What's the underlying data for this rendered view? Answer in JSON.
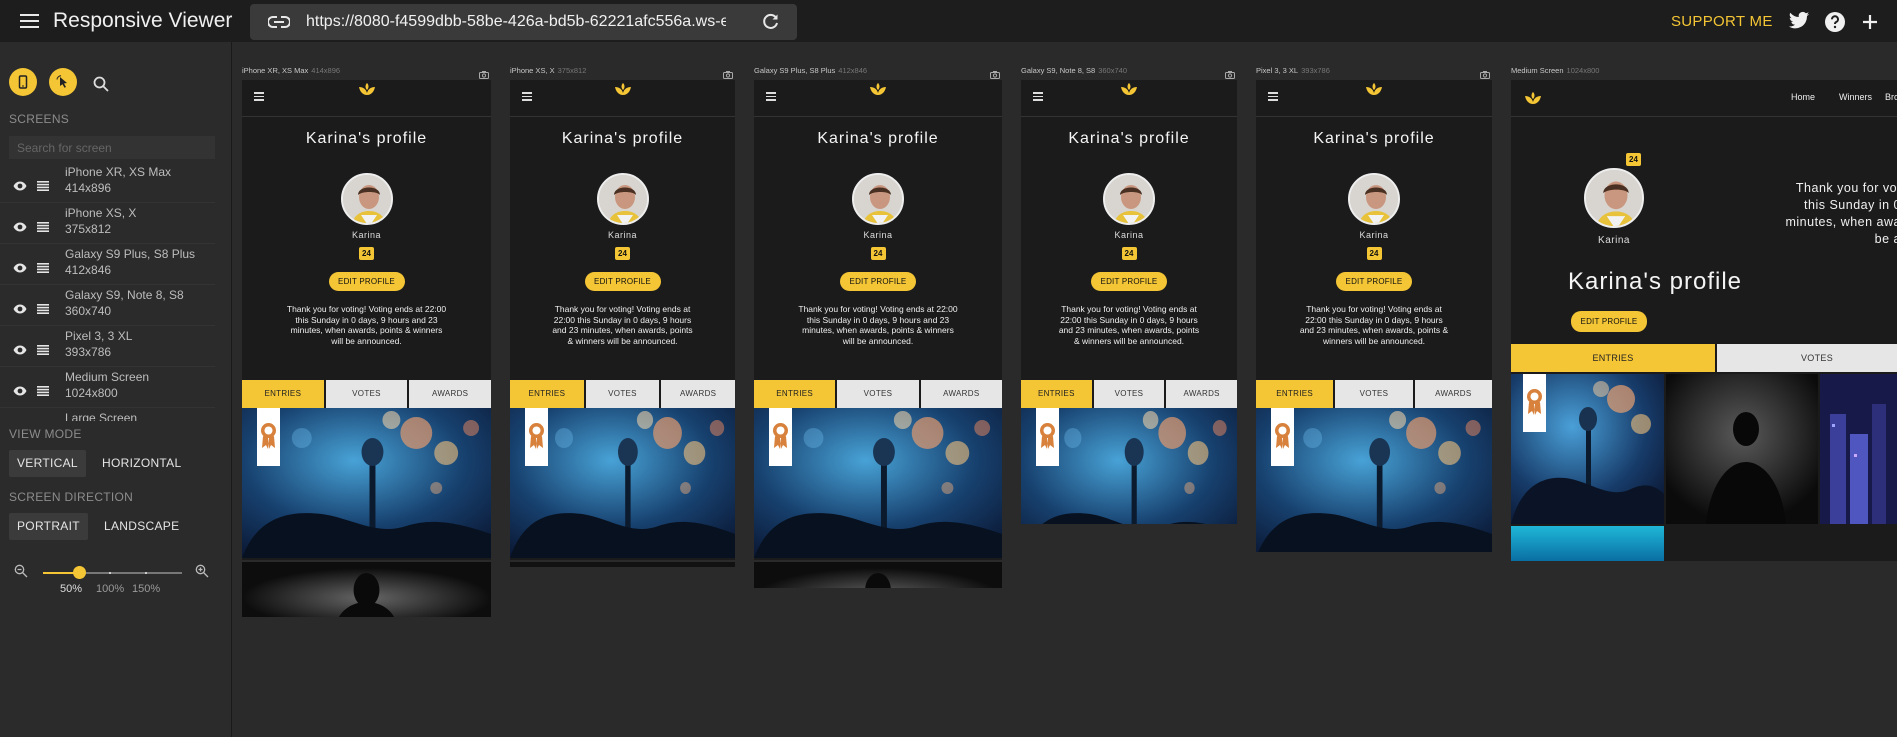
{
  "app": {
    "title": "Responsive Viewer",
    "url": "https://8080-f4599dbb-58be-426a-bd5b-62221afc556a.ws-eu0",
    "support_label": "SUPPORT ME"
  },
  "sidebar": {
    "screens_label": "SCREENS",
    "search_placeholder": "Search for screen",
    "screens": [
      {
        "name": "iPhone XR, XS Max",
        "dims": "414x896"
      },
      {
        "name": "iPhone XS, X",
        "dims": "375x812"
      },
      {
        "name": "Galaxy S9 Plus, S8 Plus",
        "dims": "412x846"
      },
      {
        "name": "Galaxy S9, Note 8, S8",
        "dims": "360x740"
      },
      {
        "name": "Pixel 3, 3 XL",
        "dims": "393x786"
      },
      {
        "name": "Medium Screen",
        "dims": "1024x800"
      },
      {
        "name": "Large Screen",
        "dims": ""
      }
    ],
    "view_mode_label": "VIEW MODE",
    "view_modes": [
      "VERTICAL",
      "HORIZONTAL"
    ],
    "view_mode_selected": "VERTICAL",
    "direction_label": "SCREEN DIRECTION",
    "directions": [
      "PORTRAIT",
      "LANDSCAPE"
    ],
    "direction_selected": "PORTRAIT",
    "zoom_levels": [
      "50%",
      "100%",
      "150%"
    ],
    "zoom_selected": "50%"
  },
  "devices": [
    {
      "label": "iPhone XR, XS Max",
      "dims": "414x896"
    },
    {
      "label": "iPhone XS, X",
      "dims": "375x812"
    },
    {
      "label": "Galaxy S9 Plus, S8 Plus",
      "dims": "412x846"
    },
    {
      "label": "Galaxy S9, Note 8, S8",
      "dims": "360x740"
    },
    {
      "label": "Pixel 3, 3 XL",
      "dims": "393x786"
    },
    {
      "label": "Medium Screen",
      "dims": "1024x800"
    }
  ],
  "profile": {
    "title": "Karina's profile",
    "user_name": "Karina",
    "badge_count": "24",
    "edit_label": "EDIT PROFILE",
    "tabs": [
      "ENTRIES",
      "VOTES",
      "AWARDS"
    ],
    "active_tab": "ENTRIES"
  },
  "messages": {
    "xr": [
      "Thank you for voting! Voting ends at 22:00",
      "this Sunday in 0 days, 9 hours and 23",
      "minutes, when awards, points & winners",
      "will be announced."
    ],
    "xs": [
      "Thank you for voting! Voting ends at",
      "22:00 this Sunday in 0 days, 9 hours",
      "and 23 minutes, when awards, points",
      "& winners will be announced."
    ],
    "s9plus": [
      "Thank you for voting! Voting ends at 22:00",
      "this Sunday in 0 days, 9 hours and 23",
      "minutes, when awards, points & winners",
      "will be announced."
    ],
    "s9": [
      "Thank you for voting! Voting ends at",
      "22:00 this Sunday in 0 days, 9 hours",
      "and 23 minutes, when awards, points",
      "& winners will be announced."
    ],
    "pixel": [
      "Thank you for voting! Voting ends at",
      "22:00 this Sunday in 0 days, 9 hours",
      "and 23 minutes, when awards, points &",
      "winners will be announced."
    ],
    "medium": [
      "Thank you for vot",
      "this Sunday in 0",
      "minutes, when awa",
      "be a"
    ]
  },
  "medium_nav": [
    "Home",
    "Winners",
    "Bro"
  ],
  "colors": {
    "accent": "#f4c534",
    "background": "#2a2a2a",
    "topbar": "#1d1d1d",
    "frame": "#1b1b1b"
  }
}
